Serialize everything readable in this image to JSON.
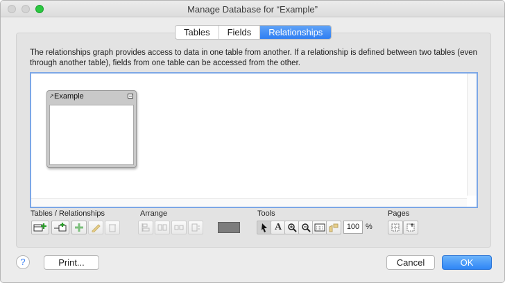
{
  "window": {
    "title": "Manage Database for “Example”"
  },
  "tabs": [
    {
      "label": "Tables",
      "active": false
    },
    {
      "label": "Fields",
      "active": false
    },
    {
      "label": "Relationships",
      "active": true
    }
  ],
  "description": "The relationships graph provides access to data in one table from another. If a relationship is defined between two tables (even through another table), fields from one table can be accessed from the other.",
  "graph": {
    "table_occurrences": [
      {
        "name": "Example"
      }
    ]
  },
  "toolbar": {
    "tables_relationships_label": "Tables / Relationships",
    "arrange_label": "Arrange",
    "tools_label": "Tools",
    "pages_label": "Pages",
    "tables_relationships_tools": [
      "add-table-icon",
      "add-relationship-icon",
      "duplicate-icon",
      "edit-icon",
      "delete-icon"
    ],
    "arrange_tools": [
      "align-icon",
      "distribute-icon",
      "resize-icon",
      "arrange-icon"
    ],
    "tools": [
      "pointer-icon",
      "text-icon",
      "zoom-in-icon",
      "zoom-out-icon",
      "view-toggle-icon",
      "tidy-icon"
    ],
    "zoom_value": "100",
    "zoom_unit": "%",
    "accent": "#2f86f6"
  },
  "footer": {
    "print_label": "Print...",
    "cancel_label": "Cancel",
    "ok_label": "OK",
    "help_glyph": "?"
  }
}
